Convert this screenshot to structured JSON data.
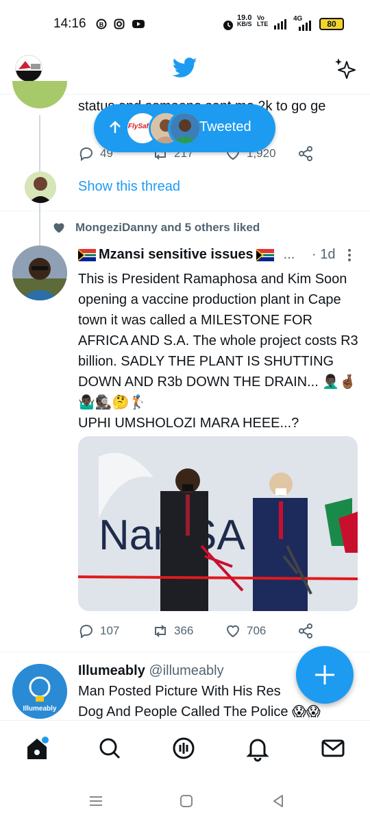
{
  "status_bar": {
    "time": "14:16",
    "net_speed_value": "19.0",
    "net_speed_unit": "KB/S",
    "volte_top": "Vo",
    "volte_bottom": "LTE",
    "signal_label": "4G",
    "battery": "80",
    "icons": [
      "b-circle-icon",
      "instagram-icon",
      "youtube-icon",
      "alarm-icon",
      "signal-icon",
      "battery-icon"
    ]
  },
  "header": {
    "brand_icon": "twitter-bird-icon",
    "sparkle_icon": "sparkle-icon"
  },
  "tweet_top": {
    "text": "status and someone sent me 2k to go ge",
    "replies": "49",
    "retweets": "217",
    "likes": "1,920",
    "show_thread": "Show this thread"
  },
  "new_tweets_pill": {
    "label": "Tweeted",
    "avatar_logo_text": "FlySafair"
  },
  "tweet_main": {
    "social_context": "MongeziDanny and 5 others liked",
    "name": "Mzansi sensitive issues",
    "name_ellipsis": "...",
    "time": "· 1d",
    "body": "This is President Ramaphosa and Kim Soon opening a vaccine production plant in Cape town it was called a MILESTONE FOR AFRICA AND S.A. The whole project costs R3 billion. SADLY THE PLANT IS SHUTTING DOWN AND R3b DOWN THE DRAIN... 🤦🏿‍♂️🤞🏾🤷🏿‍♂️🕵🏿🤔🏌🏿",
    "body_line2": "UPHI UMSHOLOZI MARA HEEE...?",
    "media_text": "NantSA",
    "replies": "107",
    "retweets": "366",
    "likes": "706"
  },
  "tweet_bottom": {
    "name": "Illumeably",
    "handle": "@illumeably",
    "body": "Man Posted Picture With His Res",
    "body_line2": "Dog And People Called The Police 😱😱",
    "avatar_text": "Illumeably"
  },
  "fab": {
    "icon": "plus-icon"
  },
  "bottom_nav": [
    "home-icon",
    "search-icon",
    "spaces-icon",
    "notifications-icon",
    "messages-icon"
  ],
  "system_nav": [
    "recents-icon",
    "home-circle-icon",
    "back-icon"
  ],
  "colors": {
    "accent": "#1d9bf0",
    "text": "#0f1419",
    "secondary": "#536471"
  }
}
